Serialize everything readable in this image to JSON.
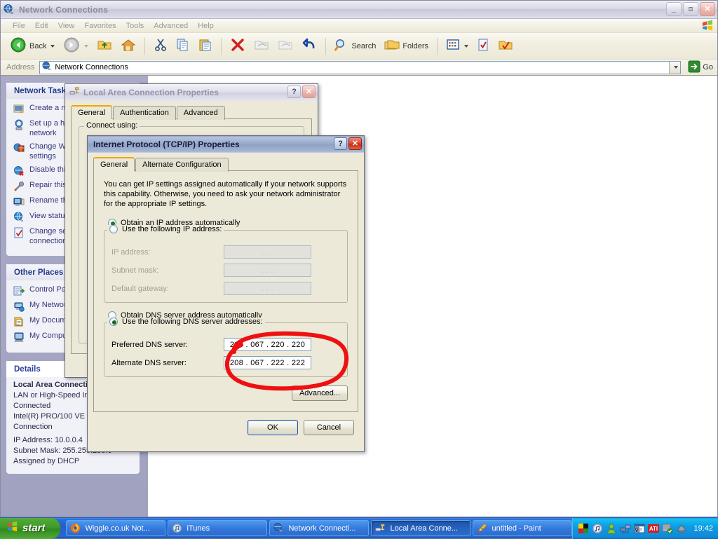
{
  "explorer": {
    "title": "Network Connections",
    "title_icon": "network-globe-icon",
    "menu": [
      "File",
      "Edit",
      "View",
      "Favorites",
      "Tools",
      "Advanced",
      "Help"
    ],
    "toolbar": {
      "back_label": "Back",
      "search_label": "Search",
      "folders_label": "Folders",
      "icons": [
        "back-arrow-icon",
        "forward-arrow-icon",
        "up-folder-icon",
        "home-icon",
        "cut-icon",
        "copy-icon",
        "paste-icon",
        "delete-icon",
        "undo-icon",
        "redo-icon",
        "search-icon",
        "folders-icon",
        "views-icon",
        "check-file-icon",
        "check-folder-icon"
      ]
    },
    "address": {
      "label": "Address",
      "value": "Network Connections",
      "icon": "network-globe-icon",
      "go_label": "Go"
    },
    "sidebar": {
      "network_tasks": {
        "title": "Network Tasks",
        "items": [
          {
            "label": "Create a new connection",
            "icon": "new-connection-icon"
          },
          {
            "label": "Set up a home or small office network",
            "icon": "home-network-icon"
          },
          {
            "label": "Change Windows Firewall settings",
            "icon": "firewall-icon"
          },
          {
            "label": "Disable this network device",
            "icon": "disable-device-icon"
          },
          {
            "label": "Repair this connection",
            "icon": "repair-icon"
          },
          {
            "label": "Rename this connection",
            "icon": "rename-icon"
          },
          {
            "label": "View status of this connection",
            "icon": "view-status-icon"
          },
          {
            "label": "Change settings of this connection",
            "icon": "change-settings-icon"
          }
        ]
      },
      "other_places": {
        "title": "Other Places",
        "items": [
          {
            "label": "Control Panel",
            "icon": "control-panel-icon"
          },
          {
            "label": "My Network Places",
            "icon": "my-network-places-icon"
          },
          {
            "label": "My Documents",
            "icon": "my-documents-icon"
          },
          {
            "label": "My Computer",
            "icon": "my-computer-icon"
          }
        ]
      },
      "details": {
        "title": "Details",
        "name": "Local Area Connection",
        "lines": [
          "LAN or High-Speed Internet",
          "Connected",
          "Intel(R) PRO/100 VE Network Connection"
        ],
        "ip_address": "IP Address: 10.0.0.4",
        "subnet_mask": "Subnet Mask: 255.255.255.0",
        "assigned": "Assigned by DHCP"
      }
    }
  },
  "lac_dialog": {
    "title": "Local Area Connection Properties",
    "icon": "network-adapter-icon",
    "help_label": "?",
    "close_label": "✕",
    "tabs": [
      {
        "label": "General",
        "selected": true
      },
      {
        "label": "Authentication",
        "selected": false
      },
      {
        "label": "Advanced",
        "selected": false
      }
    ],
    "group_legend": "Connect using:"
  },
  "tcpip_dialog": {
    "title": "Internet Protocol (TCP/IP) Properties",
    "help_label": "?",
    "close_label": "✕",
    "tabs": [
      {
        "label": "General",
        "selected": true
      },
      {
        "label": "Alternate Configuration",
        "selected": false
      }
    ],
    "description": "You can get IP settings assigned automatically if your network supports this capability. Otherwise, you need to ask your network administrator for the appropriate IP settings.",
    "ip_mode": {
      "auto_label": "Obtain an IP address automatically",
      "auto_selected": true,
      "manual_label": "Use the following IP address:",
      "manual_selected": false
    },
    "ip_fields": [
      {
        "label": "IP address:",
        "value": ".     .     .",
        "disabled": true
      },
      {
        "label": "Subnet mask:",
        "value": ".     .     .",
        "disabled": true
      },
      {
        "label": "Default gateway:",
        "value": ".     .     .",
        "disabled": true
      }
    ],
    "dns_mode": {
      "auto_label": "Obtain DNS server address automatically",
      "auto_selected": false,
      "manual_label": "Use the following DNS server addresses:",
      "manual_selected": true
    },
    "dns_fields": [
      {
        "label": "Preferred DNS server:",
        "value": "208 . 067 . 220 . 220",
        "disabled": false
      },
      {
        "label": "Alternate DNS server:",
        "value": "208 . 067 . 222 . 222",
        "disabled": false
      }
    ],
    "advanced_label": "Advanced...",
    "ok_label": "OK",
    "cancel_label": "Cancel"
  },
  "annotation": {
    "shape": "hand-drawn-red-ellipse",
    "color": "#ee1111",
    "target": "dns-server-address-fields"
  },
  "taskbar": {
    "start_label": "start",
    "start_icon": "windows-flag-icon",
    "tasks": [
      {
        "label": "Wiggle.co.uk Not...",
        "icon": "firefox-icon",
        "active": false
      },
      {
        "label": "iTunes",
        "icon": "itunes-icon",
        "active": false
      },
      {
        "label": "Network Connecti...",
        "icon": "network-globe-icon",
        "active": false
      },
      {
        "label": "Local Area Conne...",
        "icon": "network-adapter-icon",
        "active": true
      },
      {
        "label": "untitled - Paint",
        "icon": "paint-icon",
        "active": false
      }
    ],
    "tray_icons": [
      "color-blocks-icon",
      "itunes-tray-icon",
      "user-icon",
      "network-tray-icon",
      "security-icon",
      "ati-icon",
      "volume-icon",
      "update-icon"
    ],
    "clock": "19:42"
  },
  "colors": {
    "desktop": "#5a7ea4",
    "taskbar_blue": "#245fc4",
    "start_green": "#3f9a28",
    "tab_highlight": "#f0a500",
    "ink_red": "#ee1111"
  }
}
